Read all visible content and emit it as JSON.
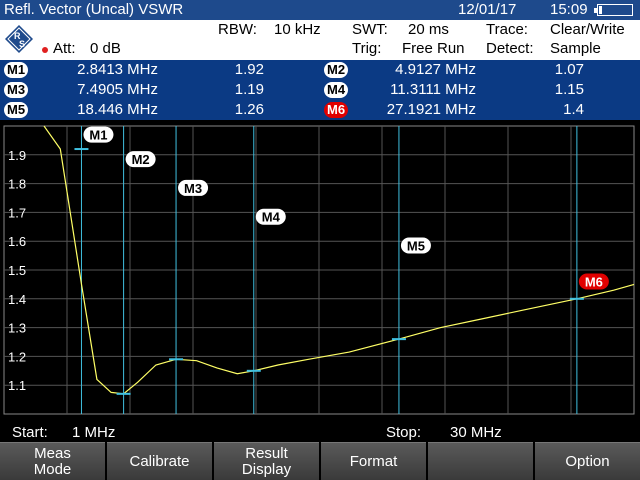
{
  "titlebar": {
    "title": "Refl. Vector (Uncal) VSWR",
    "date": "12/01/17",
    "time": "15:09"
  },
  "settings": {
    "rbw_label": "RBW:",
    "rbw_value": "10 kHz",
    "swt_label": "SWT:",
    "swt_value": "20 ms",
    "trace_label": "Trace:",
    "trace_value": "Clear/Write",
    "att_label": "Att:",
    "att_value": "0 dB",
    "trig_label": "Trig:",
    "trig_value": "Free Run",
    "detect_label": "Detect:",
    "detect_value": "Sample",
    "logo_text": "R S"
  },
  "markers": [
    {
      "id": "M1",
      "freq": "2.8413 MHz",
      "value": "1.92",
      "active": false
    },
    {
      "id": "M2",
      "freq": "4.9127 MHz",
      "value": "1.07",
      "active": false
    },
    {
      "id": "M3",
      "freq": "7.4905 MHz",
      "value": "1.19",
      "active": false
    },
    {
      "id": "M4",
      "freq": "11.3111 MHz",
      "value": "1.15",
      "active": false
    },
    {
      "id": "M5",
      "freq": "18.446 MHz",
      "value": "1.26",
      "active": false
    },
    {
      "id": "M6",
      "freq": "27.1921 MHz",
      "value": "1.4",
      "active": true
    }
  ],
  "chart_data": {
    "type": "line",
    "x_start_mhz": 1,
    "x_stop_mhz": 30,
    "ylim": [
      1.0,
      2.0
    ],
    "yticks": [
      "1.9",
      "1.8",
      "1.7",
      "1.6",
      "1.5",
      "1.4",
      "1.3",
      "1.2",
      "1.1"
    ],
    "grid": true,
    "trace_color": "#ffff66",
    "marker_line_color": "#40c0e0",
    "series": [
      {
        "x": [
          1.0,
          1.8,
          2.8413,
          3.6,
          4.3,
          4.9127,
          5.6,
          6.5,
          7.4905,
          8.5,
          9.5,
          10.5,
          11.3111,
          12.5,
          14.0,
          16.0,
          18.446,
          20.5,
          22.5,
          24.5,
          27.1921,
          29.0,
          30.0
        ],
        "y": [
          2.0,
          1.92,
          1.45,
          1.12,
          1.075,
          1.07,
          1.11,
          1.17,
          1.19,
          1.185,
          1.16,
          1.14,
          1.15,
          1.17,
          1.19,
          1.215,
          1.26,
          1.3,
          1.33,
          1.36,
          1.4,
          1.43,
          1.45
        ]
      }
    ],
    "markers": [
      {
        "label": "M1",
        "x": 2.8413,
        "y": 1.92,
        "label_y": 1.97
      },
      {
        "label": "M2",
        "x": 4.9127,
        "y": 1.07,
        "label_y": 1.885
      },
      {
        "label": "M3",
        "x": 7.4905,
        "y": 1.19,
        "label_y": 1.785
      },
      {
        "label": "M4",
        "x": 11.3111,
        "y": 1.15,
        "label_y": 1.685
      },
      {
        "label": "M5",
        "x": 18.446,
        "y": 1.26,
        "label_y": 1.585
      },
      {
        "label": "M6",
        "x": 27.1921,
        "y": 1.4,
        "label_y": 1.46
      }
    ]
  },
  "startstop": {
    "start_label": "Start:",
    "start_value": "1 MHz",
    "stop_label": "Stop:",
    "stop_value": "30 MHz"
  },
  "softkeys": [
    {
      "line1": "Meas",
      "line2": "Mode"
    },
    {
      "line1": "Calibrate",
      "line2": ""
    },
    {
      "line1": "Result",
      "line2": "Display"
    },
    {
      "line1": "Format",
      "line2": ""
    },
    {
      "line1": "",
      "line2": ""
    },
    {
      "line1": "Option",
      "line2": ""
    }
  ],
  "battery_level": 0.1
}
